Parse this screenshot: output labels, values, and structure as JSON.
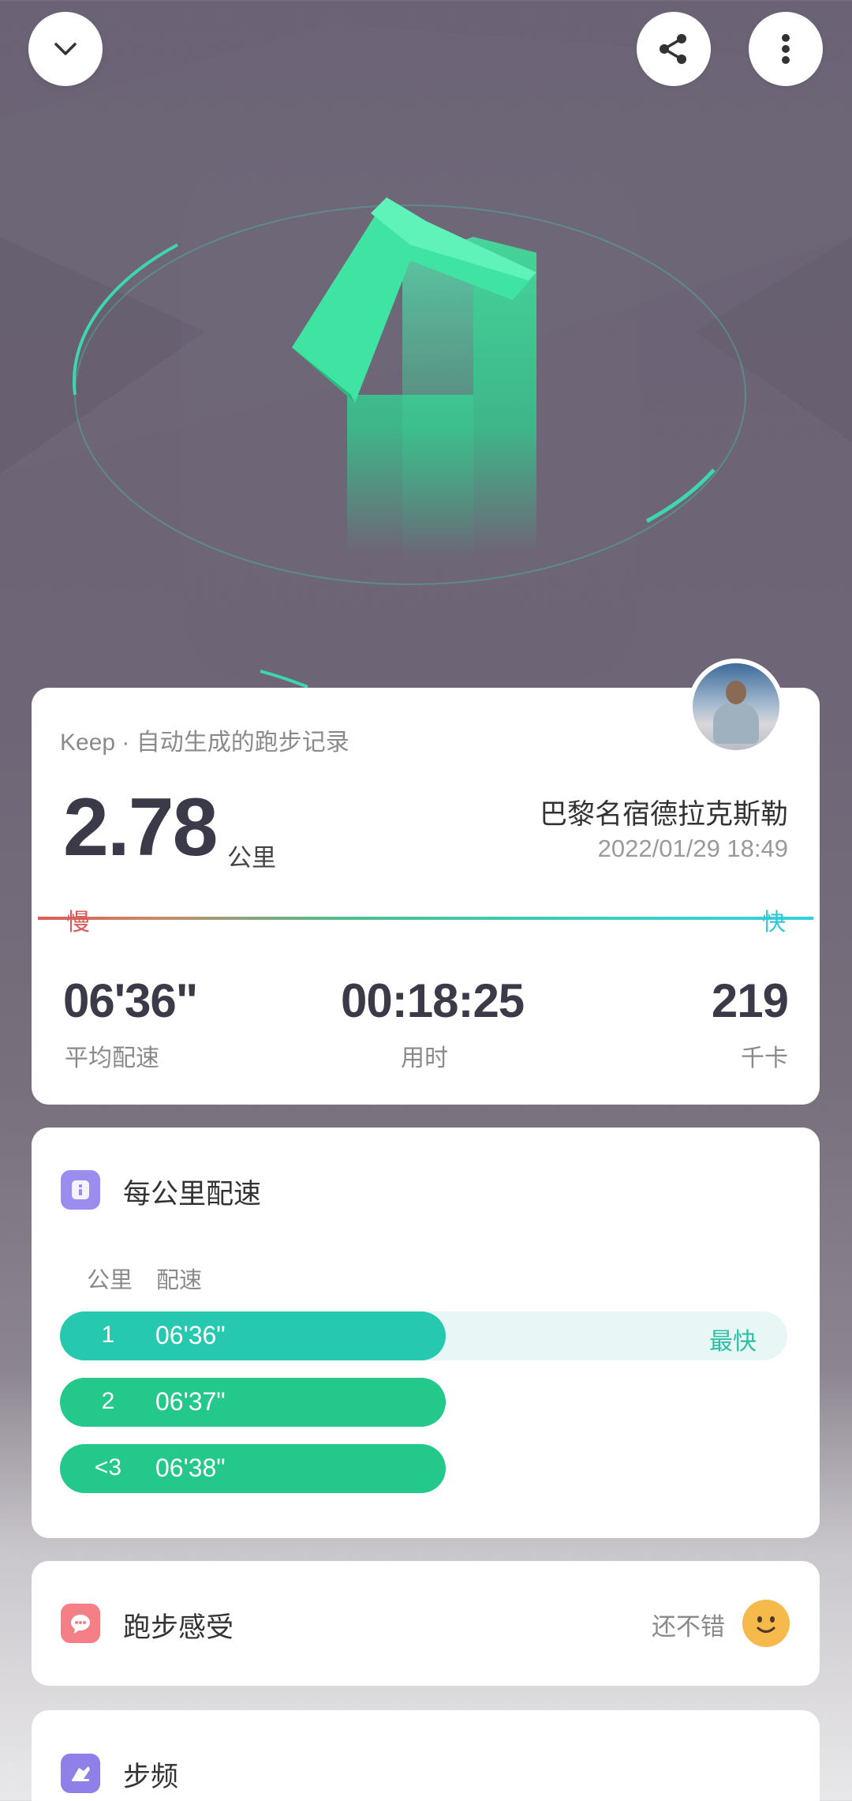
{
  "header": {
    "collapse_icon": "chevron-down-icon",
    "share_icon": "share-icon",
    "more_icon": "more-vertical-icon"
  },
  "summary": {
    "source": "Keep · 自动生成的跑步记录",
    "distance": "2.78",
    "distance_unit": "公里",
    "location": "巴黎名宿德拉克斯勒",
    "datetime": "2022/01/29 18:49",
    "slow_label": "慢",
    "fast_label": "快",
    "stats": [
      {
        "value": "06'36\"",
        "label": "平均配速"
      },
      {
        "value": "00:18:25",
        "label": "用时"
      },
      {
        "value": "219",
        "label": "千卡"
      }
    ]
  },
  "splits": {
    "title": "每公里配速",
    "col_km": "公里",
    "col_pace": "配速",
    "fastest_label": "最快",
    "rows": [
      {
        "km": "1",
        "pace": "06'36\"",
        "fraction": 0.53,
        "color": "#26c9b0"
      },
      {
        "km": "2",
        "pace": "06'37\"",
        "fraction": 0.53,
        "color": "#23c88a"
      },
      {
        "km": "<3",
        "pace": "06'38\"",
        "fraction": 0.53,
        "color": "#23c88a"
      }
    ]
  },
  "feel": {
    "title": "跑步感受",
    "value": "还不错"
  },
  "cadence": {
    "title": "步频"
  },
  "colors": {
    "accent": "#26c9b0",
    "dark_text": "#3b3a49"
  }
}
